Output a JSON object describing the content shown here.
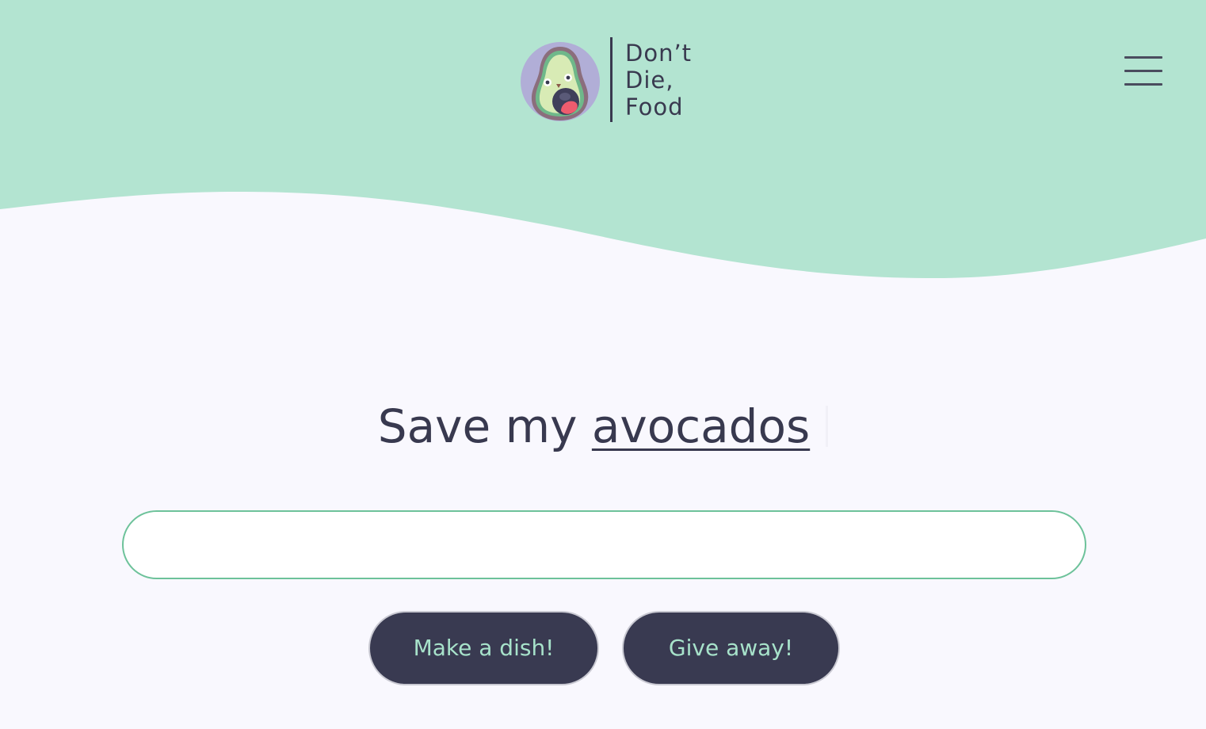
{
  "header": {
    "brand_lines": [
      "Don’t",
      "Die,",
      "Food"
    ],
    "background_color": "#b3e4d1",
    "logo_icon": "screaming-avocado-icon",
    "menu_icon": "hamburger-menu-icon"
  },
  "hero": {
    "title_prefix": "Save my",
    "title_word": "avocados",
    "text_color": "#38394f"
  },
  "search": {
    "value": "",
    "placeholder": "",
    "border_color": "#6dc29a"
  },
  "actions": {
    "make_dish_label": "Make a dish!",
    "give_away_label": "Give away!",
    "button_color": "#393a51",
    "button_text_color": "#a7e2ca"
  }
}
